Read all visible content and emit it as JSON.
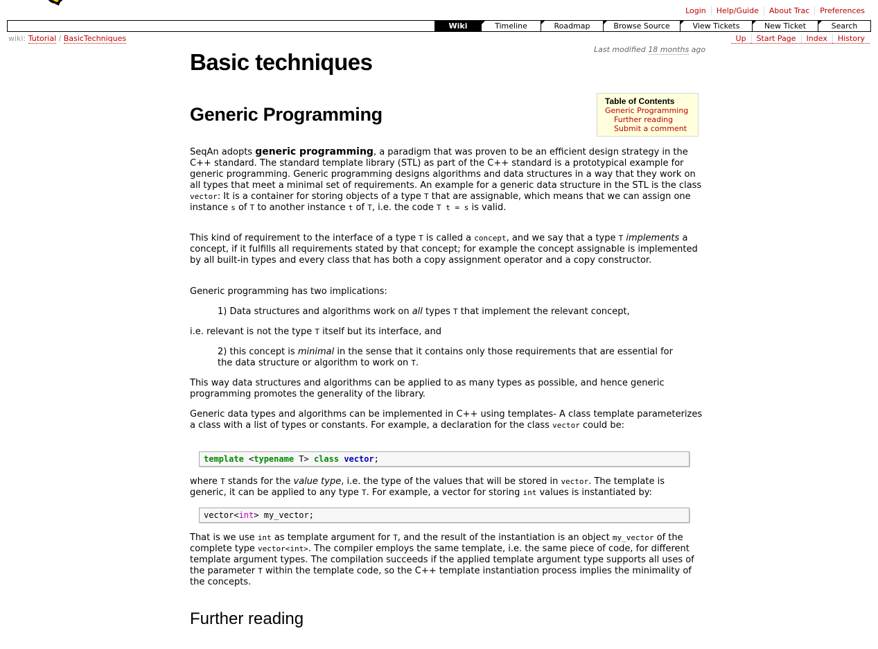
{
  "metanav": [
    "Login",
    "Help/Guide",
    "About Trac",
    "Preferences"
  ],
  "mainnav": [
    {
      "label": "Wiki",
      "active": true,
      "w": 66
    },
    {
      "label": "Timeline",
      "w": 85
    },
    {
      "label": "Roadmap",
      "w": 89
    },
    {
      "label": "Browse Source",
      "w": 110
    },
    {
      "label": "View Tickets",
      "w": 103
    },
    {
      "label": "New Ticket",
      "w": 94
    },
    {
      "label": "Search",
      "w": 75
    }
  ],
  "ctx": {
    "prefix": "wiki:",
    "crumb1": "Tutorial",
    "sep": "/",
    "crumb2": "BasicTechniques"
  },
  "ctxnav": [
    "Up",
    "Start Page",
    "Index",
    "History"
  ],
  "lastmod": {
    "prefix": "Last modified ",
    "link": "18 months",
    "suffix": " ago"
  },
  "page_title": "Basic techniques",
  "toc": {
    "title": "Table of Contents",
    "items": [
      "Generic Programming",
      "Further reading",
      "Submit a comment"
    ]
  },
  "h_generic": "Generic Programming",
  "h_further": "Further reading",
  "p1": {
    "a": "SeqAn adopts ",
    "b": "generic programming",
    "c": ", a paradigm that was proven to be an efficient design strategy in the C++ standard. The standard template library (STL) as part of the C++ standard is a prototypical example for generic programming. Generic programming designs algorithms and data structures in a way that they work on all types that meet a minimal set of requirements. An example for a generic data structure in the STL is the class ",
    "vector": "vector",
    "d": ": It is a container for storing objects of a type ",
    "T1": "T",
    "e": " that are assignable, which means that we can assign one instance ",
    "s1": "s",
    "f": " of ",
    "T2": "T",
    "g": " to another instance ",
    "t1": "t",
    "h": " of ",
    "T3": "T",
    "i": ", i.e. the code ",
    "code": "T t = s",
    "j": " is valid."
  },
  "p2": {
    "a": "This kind of requirement to the interface of a type ",
    "T": "T",
    "b": " is called a ",
    "concept": "concept",
    "c": ", and we say that a type ",
    "T2": "T",
    "impl": "implements",
    "d": " a concept, if it fulfills all requirements stated by that concept; for example the concept assignable is implemented by all built-in types and every class that has both a copy assignment operator and a copy constructor."
  },
  "p3": "Generic programming has two implications:",
  "p4": {
    "a": "1) Data structures and algorithms work on ",
    "all": "all",
    "b": " types ",
    "T": "T",
    "c": " that implement the relevant concept,"
  },
  "p5": {
    "a": "i.e. relevant is not the type ",
    "T": "T",
    "b": " itself but its interface, and"
  },
  "p6": {
    "a": "2) this concept is ",
    "minimal": "minimal",
    "b": " in the sense that it contains only those requirements that are essential for the data structure or algorithm to work on ",
    "T": "T",
    "c": "."
  },
  "p7": "This way data structures and algorithms can be applied to as many types as possible, and hence generic programming promotes the generality of the library.",
  "p8": {
    "a": "Generic data types and algorithms can be implemented in C++ using templates- A class template parameterizes a class with a list of types or constants. For example, a declaration for the class ",
    "vector": "vector",
    "b": " could be:"
  },
  "code1": {
    "kw1": "template",
    "lt": " <",
    "kw2": "typename",
    "T": " T",
    "gt": "> ",
    "kw3": "class",
    "sp": " ",
    "ty": "vector",
    "end": ";"
  },
  "p9": {
    "a": "where ",
    "T": "T",
    "b": " stands for the ",
    "vt": "value type",
    "c": ", i.e. the type of the values that will be stored in ",
    "vector": "vector",
    "d": ". The template is generic, it can be applied to any type ",
    "T2": "T",
    "e": ". For example, a vector for storing ",
    "int": "int",
    "f": " values is instantiated by:"
  },
  "code2": {
    "a": "vector<",
    "int": "int",
    "b": "> my_vector;"
  },
  "p10": {
    "a": "That is we use ",
    "int": "int",
    "b": " as template argument for ",
    "T": "T",
    "c": ", and the result of the instantiation is an object ",
    "myv": "my_vector",
    "d": " of the complete type ",
    "vi": "vector<int>",
    "e": ". The compiler employs the same template, i.e. the same piece of code, for different template argument types. The compilation succeeds if the applied template argument type supports all uses of the parameter ",
    "T2": "T",
    "f": " within the template code, so the C++ template instantiation process implies the minimality of the concepts."
  }
}
